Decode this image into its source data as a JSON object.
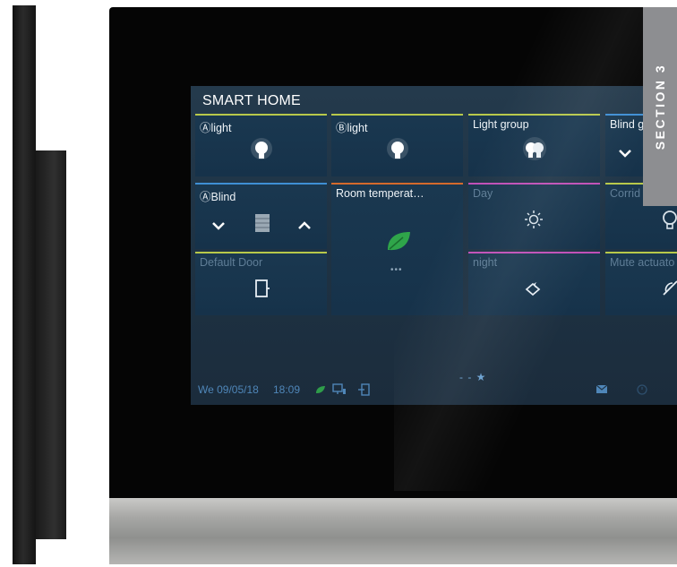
{
  "screen": {
    "title": "SMART HOME",
    "tiles": [
      {
        "label": "Ⓐlight",
        "bar": "#b8c94a",
        "icon": "bulb-icon"
      },
      {
        "label": "Ⓑlight",
        "bar": "#b8c94a",
        "icon": "bulb-icon"
      },
      {
        "label": "Light group",
        "bar": "#b8c94a",
        "icon": "bulb-group-icon"
      },
      {
        "label": "Blind g",
        "bar": "#3f8fd4",
        "icon": "chevron-down-icon"
      },
      {
        "label": "ⒶBlind",
        "bar": "#3f8fd4",
        "icon": "blind-icon"
      },
      {
        "label": "Room temperat…",
        "bar": "#d46a2c",
        "icon": "leaf-icon"
      },
      {
        "label": "Day",
        "bar": "#c04fb7",
        "icon": "sun-icon"
      },
      {
        "label": "Corrid",
        "bar": "#b8c94a",
        "icon": "bulb-outline-icon"
      },
      {
        "label": "Default Door",
        "bar": "#b8c94a",
        "icon": "door-icon"
      },
      {
        "label": "night",
        "bar": "#c04fb7",
        "icon": "moon-icon"
      },
      {
        "label": "Mute actuato",
        "bar": "#b8c94a",
        "icon": "mute-icon"
      }
    ],
    "status": {
      "date": "We 09/05/18",
      "time": "18:09",
      "page_dots": "- - ★"
    }
  },
  "section_tab": "SECTION 3",
  "colors": {
    "screen_bg": "#1f3446",
    "tile_bg": "#183650",
    "status_text": "#4f86b8",
    "section_tab_bg": "#8d8e91"
  }
}
